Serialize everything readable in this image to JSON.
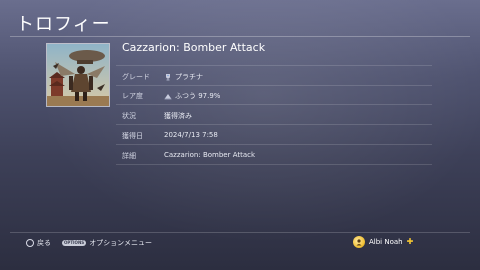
{
  "header": {
    "title": "トロフィー"
  },
  "trophy": {
    "name": "Cazzarion: Bomber Attack",
    "art_icon": "warrior-airship-artwork",
    "details": [
      {
        "label": "グレード",
        "value": "プラチナ",
        "icon": "platinum-trophy-icon"
      },
      {
        "label": "レア度",
        "value": "ふつう  97.9%",
        "icon": "rarity-common-icon"
      },
      {
        "label": "状況",
        "value": "獲得済み",
        "icon": ""
      },
      {
        "label": "獲得日",
        "value": "2024/7/13   7:58",
        "icon": ""
      },
      {
        "label": "詳細",
        "value": "Cazzarion: Bomber Attack",
        "icon": ""
      }
    ]
  },
  "footer": {
    "back_label": "戻る",
    "options_badge": "OPTIONS",
    "options_label": "オプションメニュー"
  },
  "user": {
    "name": "Albi Noah",
    "avatar_icon": "avatar-icon",
    "plus_icon": "ps-plus-icon"
  },
  "colors": {
    "background_top": "#6a6e8e",
    "background_bottom": "#2c2e40",
    "plus_gold": "#f3c632"
  }
}
